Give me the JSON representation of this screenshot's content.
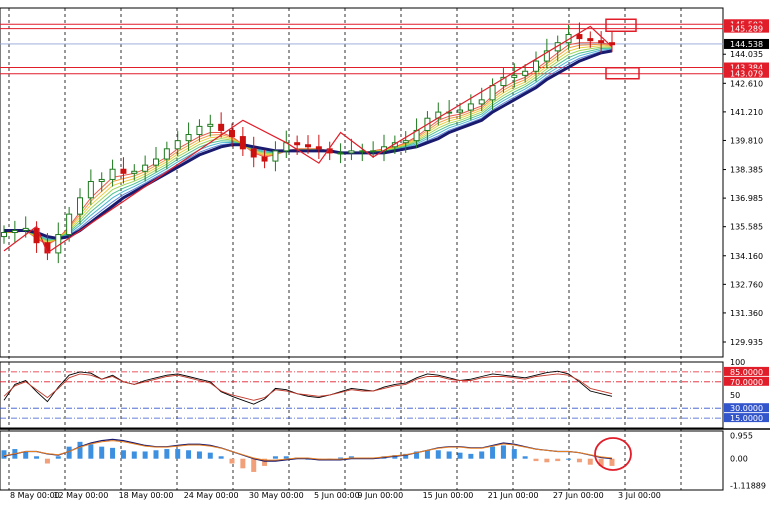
{
  "chart_data": [
    {
      "type": "candlestick",
      "panel": "main",
      "y_ticks": [
        "144.035",
        "142.610",
        "141.210",
        "139.810",
        "138.385",
        "136.985",
        "135.585",
        "134.160",
        "132.760",
        "131.360",
        "129.935"
      ],
      "y_range": [
        129.2,
        146.3
      ],
      "x_ticks": [
        "8 May 00:00",
        "12 May 00:00",
        "18 May 00:00",
        "24 May 00:00",
        "30 May 00:00",
        "5 Jun 00:00",
        "9 Jun 00:00",
        "15 Jun 00:00",
        "21 Jun 00:00",
        "27 Jun 00:00",
        "3 Jul 00:00"
      ],
      "current_price": "144.538",
      "level_labels": [
        "145.503",
        "145.289",
        "143.384",
        "143.079"
      ],
      "level_values": [
        145.503,
        145.289,
        143.384,
        143.079
      ],
      "colors": {
        "bull": "#1e7a1e",
        "bear": "#cc1111",
        "level": "#e11d2a",
        "price_line": "#8fa5d6",
        "ma_slow": "#1a1a6e"
      },
      "x": [
        "8 May",
        "9 May",
        "10 May",
        "11 May",
        "12 May",
        "13 May",
        "14 May",
        "15 May",
        "16 May",
        "17 May",
        "18 May",
        "19 May",
        "20 May",
        "21 May",
        "22 May",
        "23 May",
        "24 May",
        "25 May",
        "26 May",
        "27 May",
        "28 May",
        "29 May",
        "30 May",
        "31 May",
        "1 Jun",
        "2 Jun",
        "3 Jun",
        "4 Jun",
        "5 Jun",
        "6 Jun",
        "7 Jun",
        "8 Jun",
        "9 Jun",
        "10 Jun",
        "11 Jun",
        "12 Jun",
        "13 Jun",
        "14 Jun",
        "15 Jun",
        "16 Jun",
        "17 Jun",
        "18 Jun",
        "19 Jun",
        "20 Jun",
        "21 Jun",
        "22 Jun",
        "23 Jun",
        "24 Jun",
        "25 Jun",
        "26 Jun",
        "27 Jun",
        "28 Jun",
        "29 Jun",
        "30 Jun",
        "1 Jul",
        "2 Jul",
        "3 Jul"
      ],
      "close": [
        135.3,
        135.4,
        135.5,
        134.8,
        134.3,
        135.2,
        136.2,
        137.0,
        137.8,
        137.9,
        138.4,
        138.2,
        138.3,
        138.6,
        138.9,
        139.4,
        139.8,
        140.1,
        140.5,
        140.6,
        140.3,
        140.0,
        139.4,
        139.0,
        138.8,
        139.3,
        139.7,
        139.6,
        139.5,
        139.4,
        139.2,
        139.2,
        139.3,
        139.3,
        139.3,
        139.5,
        139.7,
        139.8,
        140.3,
        140.9,
        141.2,
        141.2,
        141.3,
        141.6,
        141.8,
        142.5,
        142.9,
        143.0,
        143.2,
        143.7,
        144.2,
        144.6,
        145.0,
        144.8,
        144.7,
        144.6,
        144.5
      ],
      "fast_ma": [
        135.3,
        135.3,
        135.4,
        135.0,
        134.7,
        135.0,
        135.6,
        136.3,
        137.0,
        137.5,
        138.0,
        138.1,
        138.2,
        138.4,
        138.7,
        139.0,
        139.4,
        139.7,
        140.0,
        140.2,
        140.2,
        140.0,
        139.6,
        139.2,
        139.0,
        139.1,
        139.3,
        139.4,
        139.4,
        139.4,
        139.3,
        139.2,
        139.2,
        139.2,
        139.3,
        139.4,
        139.5,
        139.7,
        140.0,
        140.4,
        140.8,
        141.0,
        141.1,
        141.3,
        141.5,
        142.0,
        142.4,
        142.7,
        142.9,
        143.3,
        143.7,
        144.1,
        144.5,
        144.6,
        144.6,
        144.6,
        144.5
      ],
      "slow_ma": [
        135.4,
        135.4,
        135.4,
        135.3,
        135.1,
        135.0,
        135.1,
        135.4,
        135.8,
        136.2,
        136.6,
        137.0,
        137.3,
        137.6,
        137.9,
        138.2,
        138.5,
        138.8,
        139.1,
        139.3,
        139.5,
        139.6,
        139.6,
        139.5,
        139.4,
        139.3,
        139.3,
        139.3,
        139.3,
        139.3,
        139.3,
        139.2,
        139.2,
        139.2,
        139.2,
        139.2,
        139.3,
        139.4,
        139.5,
        139.7,
        139.9,
        140.2,
        140.4,
        140.6,
        140.8,
        141.2,
        141.5,
        141.8,
        142.1,
        142.4,
        142.8,
        143.1,
        143.4,
        143.7,
        143.9,
        144.1,
        144.2
      ],
      "zigzag": [
        [
          0,
          134.4
        ],
        [
          3,
          135.6
        ],
        [
          4,
          134.3
        ],
        [
          22,
          140.8
        ],
        [
          26,
          139.7
        ],
        [
          29,
          138.7
        ],
        [
          31,
          140.2
        ],
        [
          34,
          139.0
        ],
        [
          54,
          145.4
        ],
        [
          56,
          144.4
        ]
      ]
    },
    {
      "type": "line",
      "panel": "oscillator",
      "y_ticks": [
        "100",
        "50"
      ],
      "levels": [
        "85.0000",
        "70.0000",
        "30.0000",
        "15.0000"
      ],
      "level_values": [
        85,
        70,
        30,
        15
      ],
      "y_range": [
        0,
        100
      ],
      "series": [
        {
          "values": [
            42,
            66,
            72,
            55,
            40,
            62,
            80,
            85,
            83,
            74,
            80,
            70,
            66,
            72,
            76,
            80,
            82,
            78,
            74,
            70,
            55,
            48,
            42,
            36,
            44,
            60,
            58,
            52,
            48,
            46,
            50,
            55,
            60,
            58,
            56,
            62,
            66,
            68,
            76,
            82,
            80,
            76,
            72,
            74,
            78,
            82,
            80,
            78,
            76,
            80,
            84,
            86,
            82,
            70,
            56,
            52,
            48
          ]
        },
        {
          "values": [
            48,
            64,
            70,
            58,
            46,
            60,
            76,
            82,
            80,
            74,
            78,
            70,
            66,
            70,
            74,
            78,
            80,
            76,
            72,
            68,
            56,
            50,
            46,
            42,
            46,
            58,
            56,
            52,
            50,
            48,
            50,
            54,
            58,
            56,
            56,
            60,
            64,
            66,
            74,
            78,
            78,
            74,
            72,
            72,
            76,
            78,
            78,
            76,
            74,
            78,
            80,
            82,
            80,
            72,
            60,
            56,
            52
          ]
        }
      ]
    },
    {
      "type": "bar",
      "panel": "macd",
      "y_ticks": [
        "0.955",
        "0.00",
        "-1.11889"
      ],
      "y_range": [
        -1.3,
        1.15
      ],
      "histogram": [
        0.35,
        0.4,
        0.3,
        0.1,
        -0.2,
        0.1,
        0.5,
        0.7,
        0.6,
        0.5,
        0.45,
        0.35,
        0.3,
        0.3,
        0.35,
        0.4,
        0.4,
        0.35,
        0.3,
        0.25,
        0.1,
        -0.2,
        -0.4,
        -0.55,
        -0.3,
        0.1,
        0.1,
        0.05,
        0.0,
        -0.05,
        0.0,
        0.05,
        0.1,
        0.05,
        0.05,
        0.1,
        0.15,
        0.2,
        0.3,
        0.35,
        0.35,
        0.3,
        0.25,
        0.2,
        0.3,
        0.5,
        0.55,
        0.4,
        0.1,
        -0.1,
        -0.15,
        -0.1,
        0.0,
        -0.15,
        -0.25,
        -0.3,
        -0.3
      ],
      "signal": [
        0.1,
        0.2,
        0.3,
        0.3,
        0.2,
        0.15,
        0.3,
        0.5,
        0.65,
        0.75,
        0.8,
        0.75,
        0.65,
        0.55,
        0.5,
        0.5,
        0.55,
        0.6,
        0.6,
        0.55,
        0.45,
        0.3,
        0.15,
        0.0,
        -0.1,
        -0.1,
        -0.05,
        0.0,
        0.0,
        -0.05,
        -0.05,
        -0.05,
        0.0,
        0.0,
        0.0,
        0.05,
        0.1,
        0.15,
        0.25,
        0.35,
        0.45,
        0.5,
        0.5,
        0.45,
        0.45,
        0.55,
        0.65,
        0.6,
        0.5,
        0.4,
        0.35,
        0.3,
        0.3,
        0.25,
        0.15,
        0.05,
        0.0
      ]
    }
  ]
}
